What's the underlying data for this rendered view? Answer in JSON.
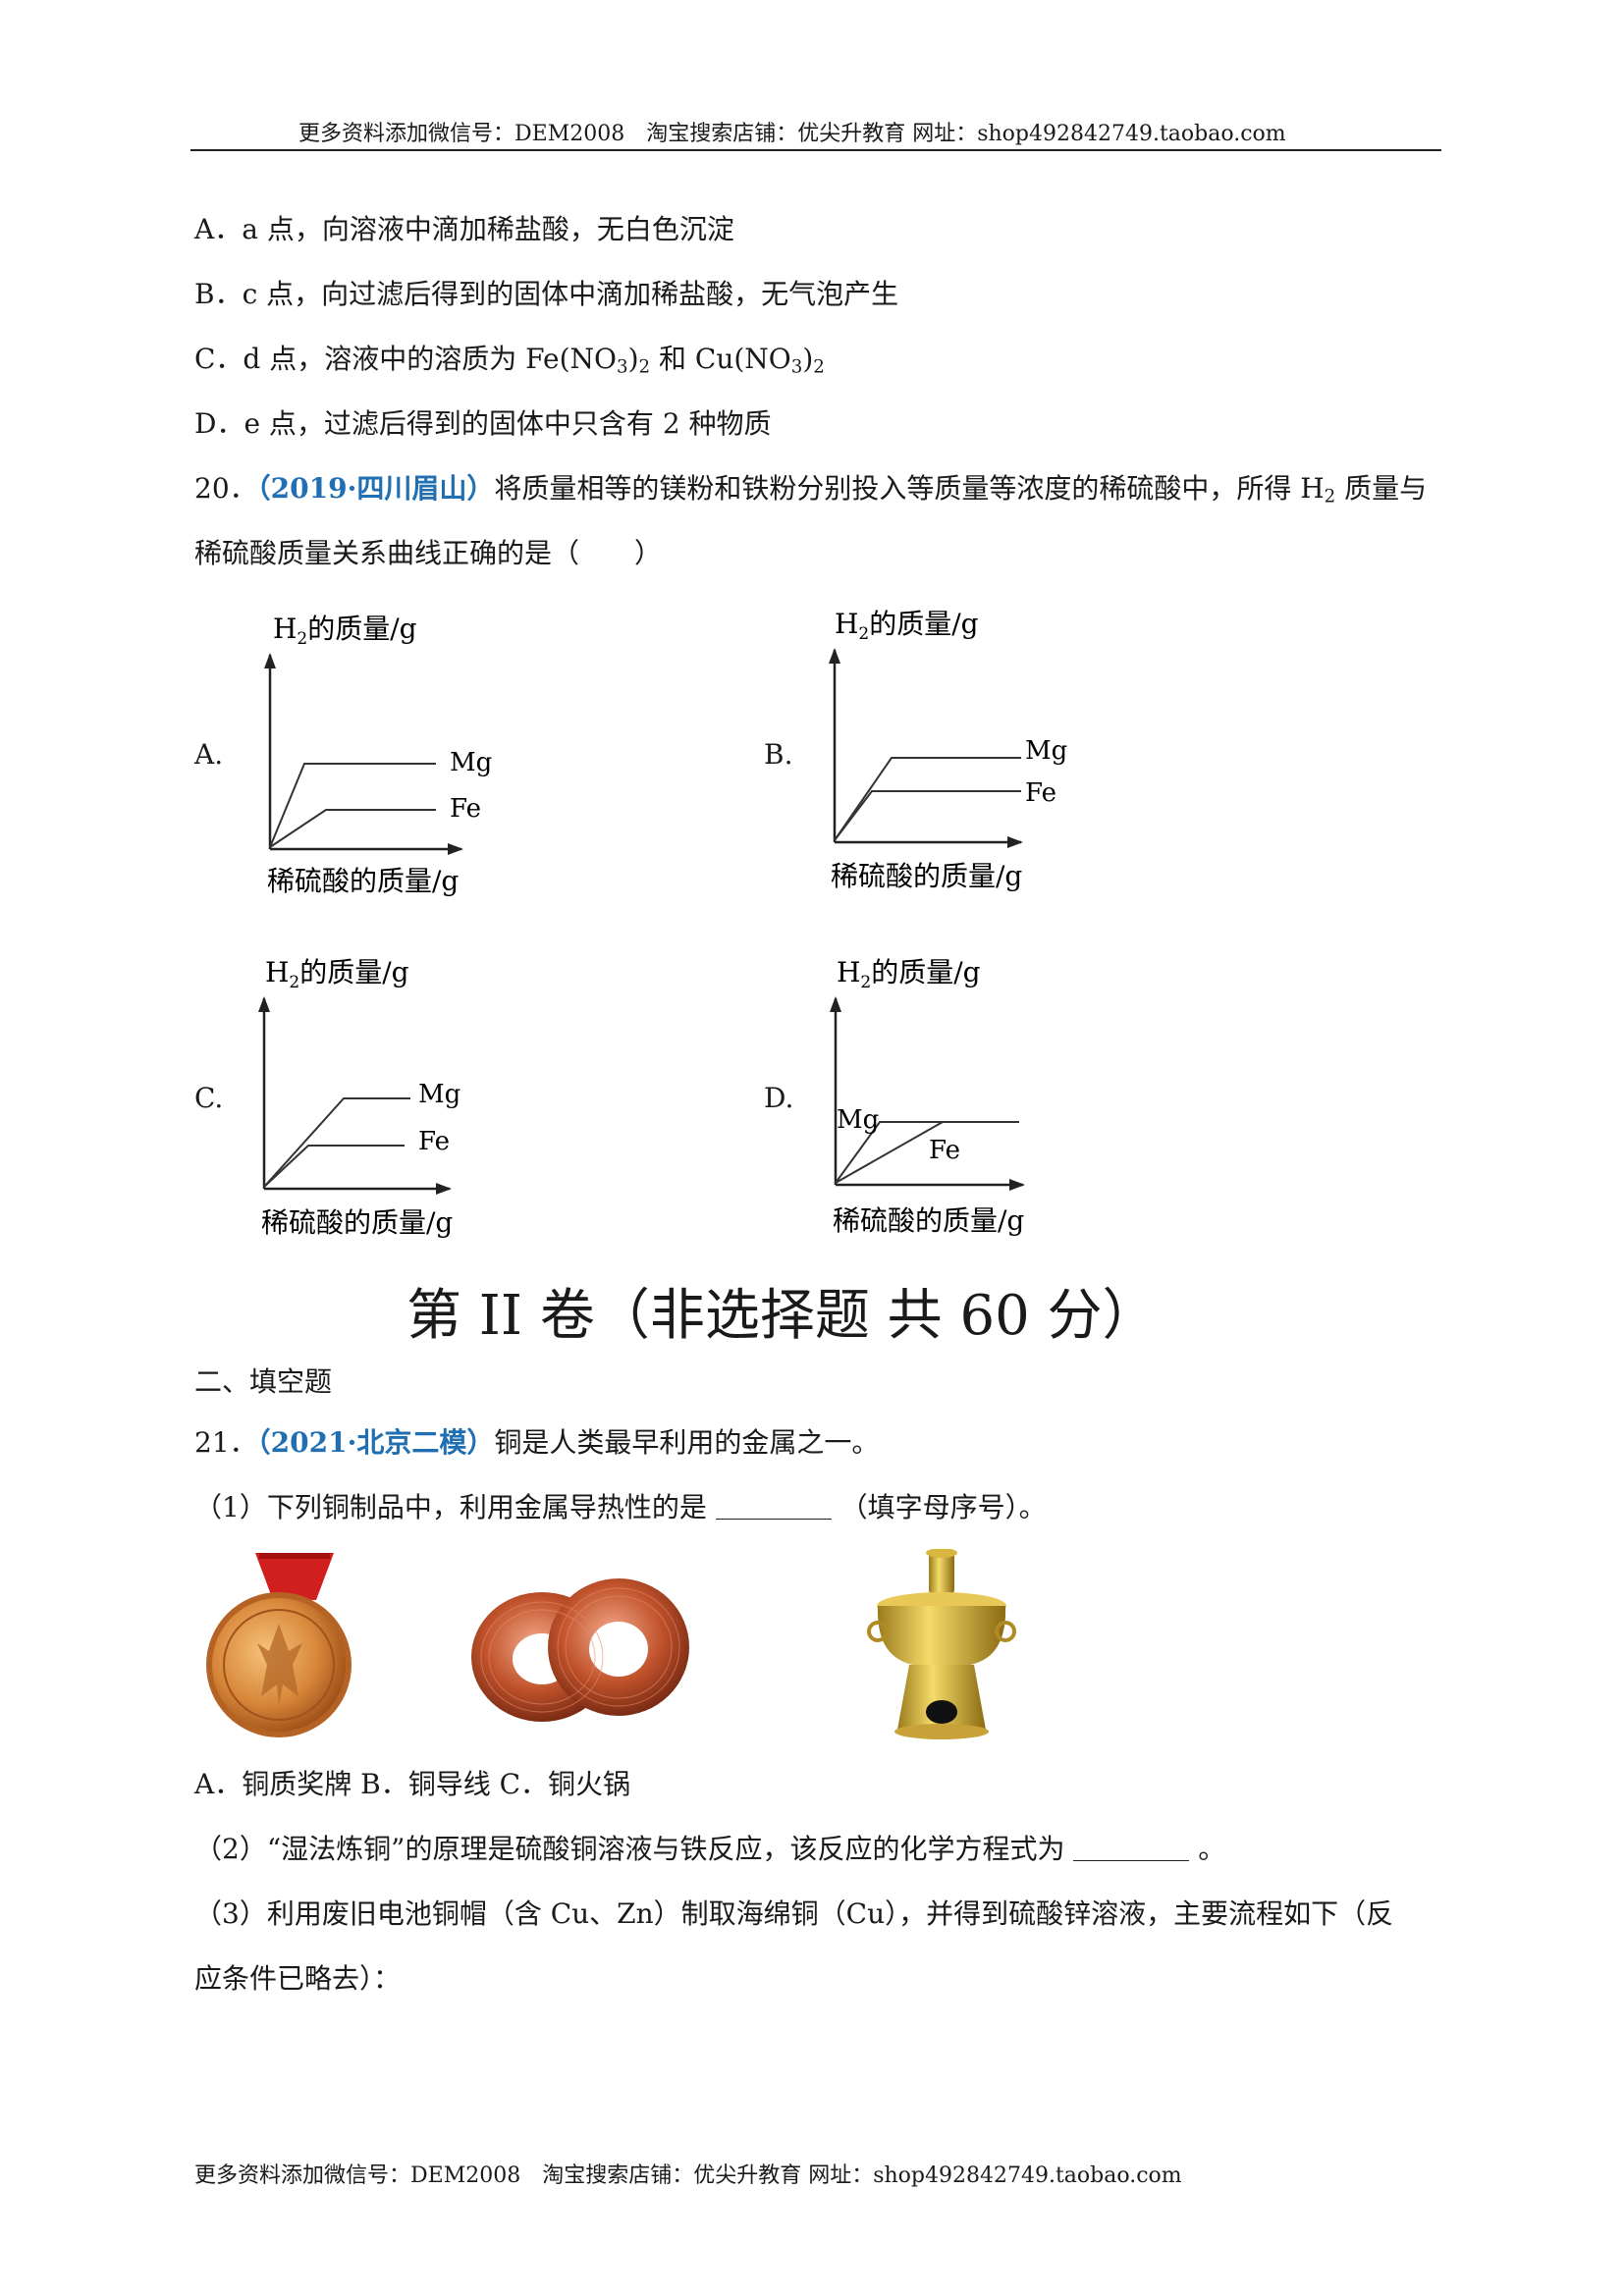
{
  "header": "更多资料添加微信号：DEM2008　淘宝搜索店铺：优尖升教育  网址：shop492842749.taobao.com",
  "footer": "更多资料添加微信号：DEM2008　淘宝搜索店铺：优尖升教育  网址：shop492842749.taobao.com",
  "q19_options": {
    "A": "A．a 点，向溶液中滴加稀盐酸，无白色沉淀",
    "B": "B．c 点，向过滤后得到的固体中滴加稀盐酸，无气泡产生",
    "C_prefix": "C．d 点，溶液中的溶质为 Fe(NO",
    "C_mid": ")",
    "C_and": " 和 Cu(NO",
    "C_end": ")",
    "sub3": "3",
    "sub2": "2",
    "D": "D．e 点，过滤后得到的固体中只含有 2 种物质"
  },
  "q20": {
    "number": "20．",
    "source": "（2019·四川眉山）",
    "text1": "将质量相等的镁粉和铁粉分别投入等质量等浓度的稀硫酸中，所得 H",
    "sub": "2",
    "text1_end": " 质量与",
    "text2": "稀硫酸质量关系曲线正确的是（　　）",
    "y_label_pre": "H",
    "y_label_sub": "2",
    "y_label_post": "的质量/g",
    "x_label": "稀硫酸的质量/g",
    "series": [
      "Mg",
      "Fe"
    ],
    "options": [
      "A.",
      "B.",
      "C.",
      "D."
    ]
  },
  "section_title": "第 II 卷（非选择题  共 60 分）",
  "section2": "二、填空题",
  "q21": {
    "number": "21．",
    "source": "（2021·北京二模）",
    "text": "铜是人类最早利用的金属之一。",
    "p1_pre": "（1）下列铜制品中，利用金属导热性的是",
    "p1_post": "（填字母序号）。",
    "choices": "A．铜质奖牌  B．铜导线  C．铜火锅",
    "p2_pre": "（2）“湿法炼铜”的原理是硫酸铜溶液与铁反应，该反应的化学方程式为",
    "p2_post": "。",
    "p3_line1": "（3）利用废旧电池铜帽（含  Cu、Zn）制取海绵铜（Cu），并得到硫酸锌溶液，主要流程如下（反",
    "p3_line2": "应条件已略去）："
  },
  "colors": {
    "source": "#1f6fb2",
    "gold": "#d9a23a",
    "copper": "#b4532a",
    "ribbon": "#d11f1f"
  }
}
